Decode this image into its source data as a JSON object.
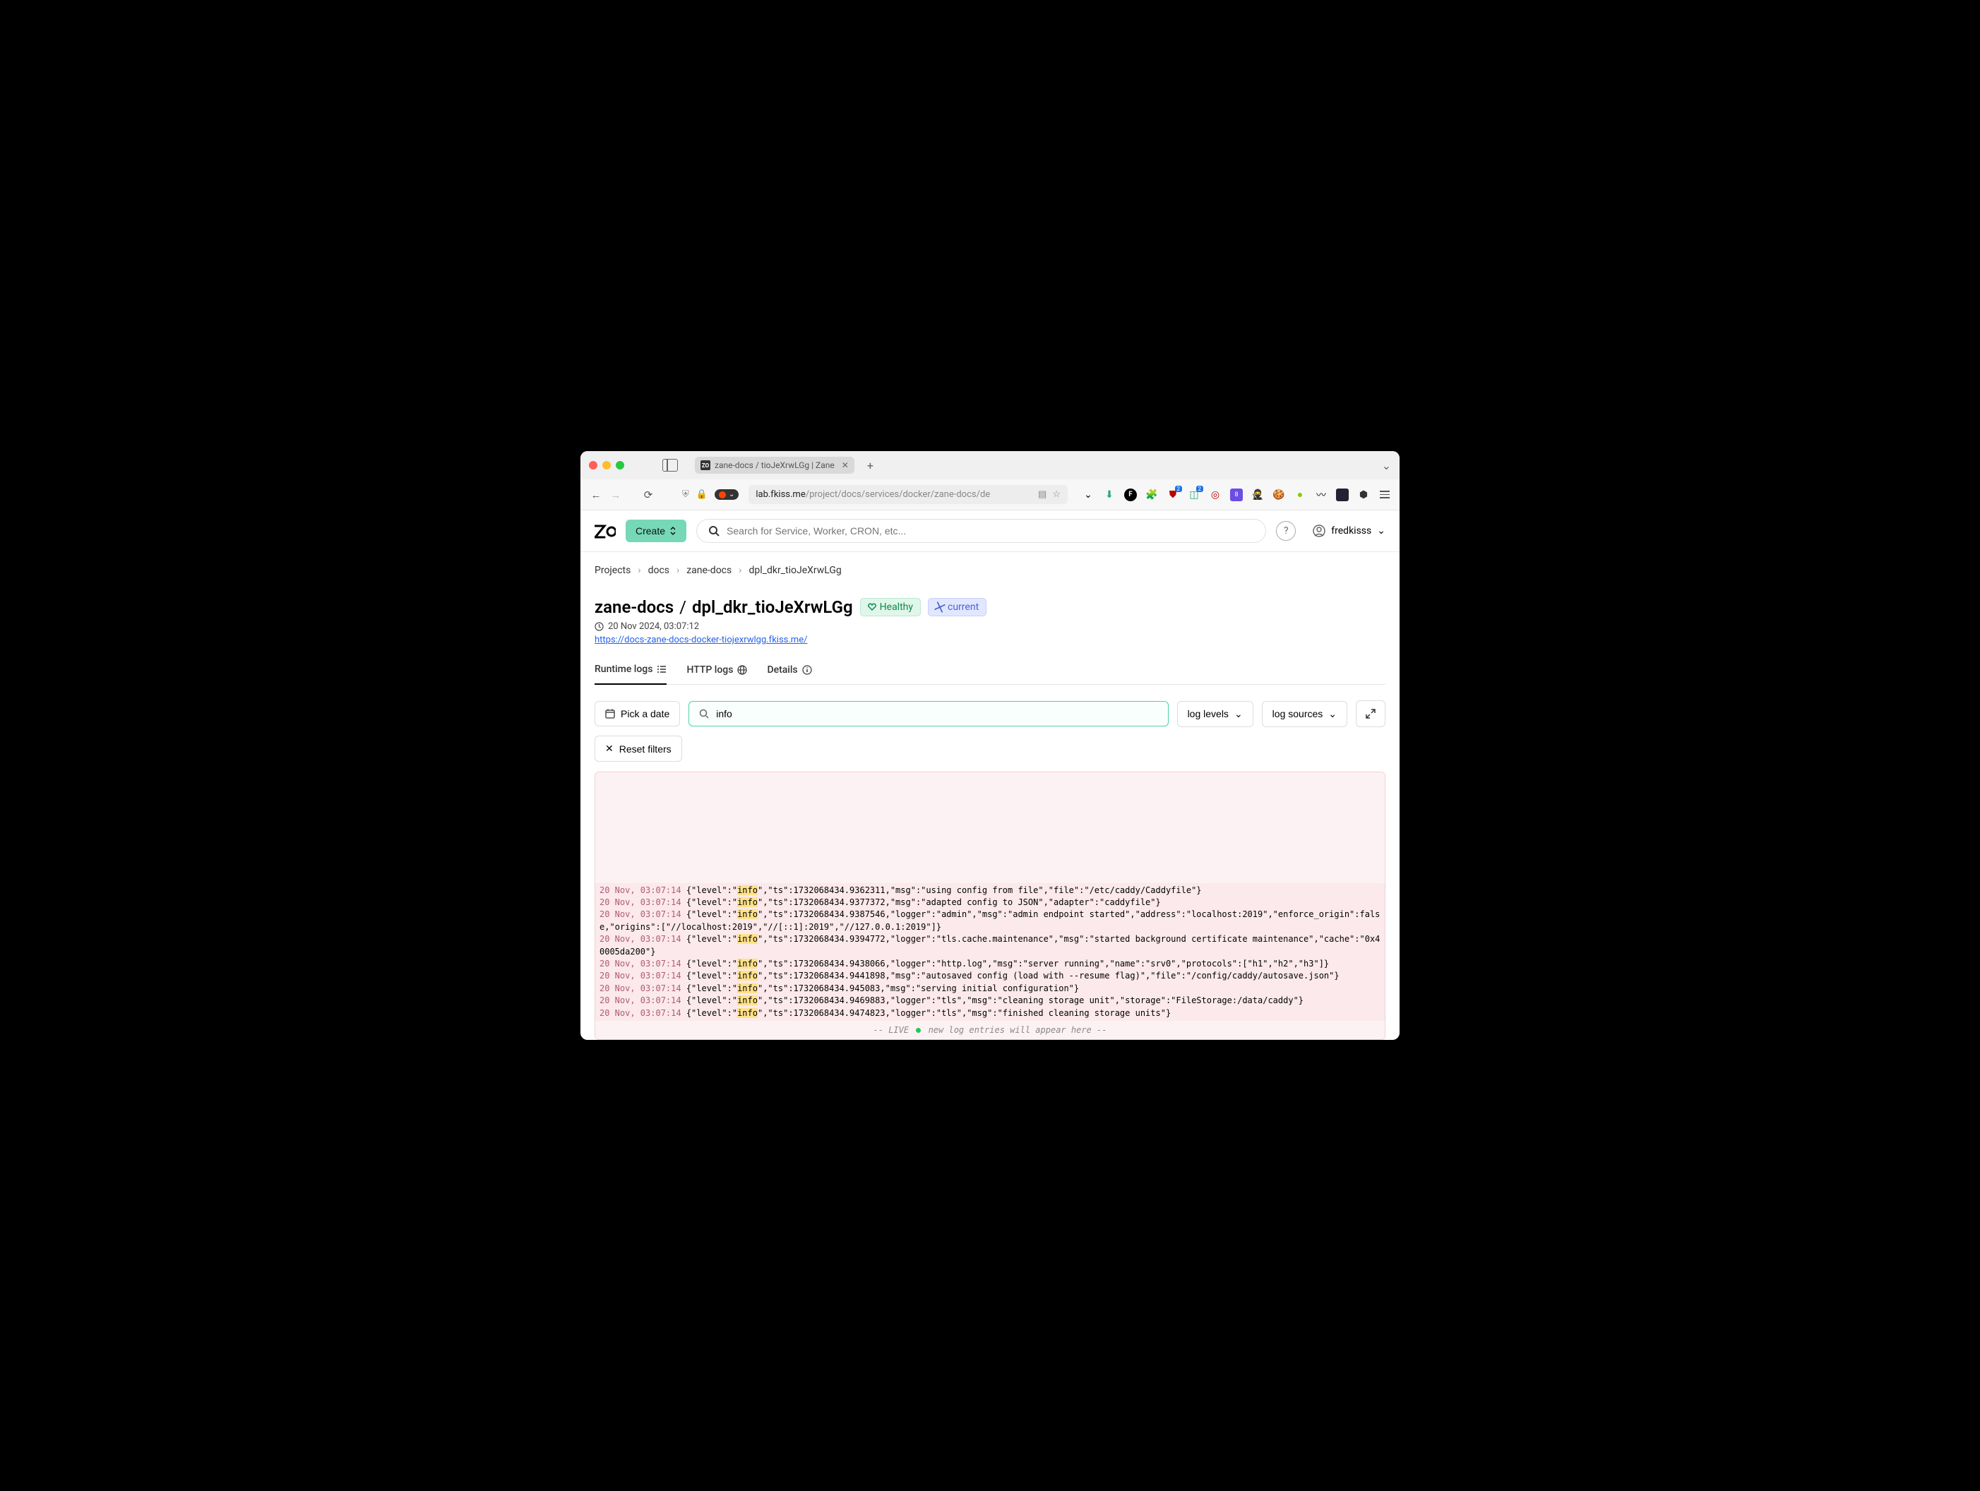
{
  "browser": {
    "tab_title": "zane-docs / tioJeXrwLGg | Zane",
    "url_host": "lab.fkiss.me",
    "url_path": "/project/docs/services/docker/zane-docs/de"
  },
  "header": {
    "create_label": "Create",
    "search_placeholder": "Search for Service, Worker, CRON, etc...",
    "username": "fredkisss"
  },
  "breadcrumb": {
    "items": [
      "Projects",
      "docs",
      "zane-docs",
      "dpl_dkr_tioJeXrwLGg"
    ]
  },
  "page": {
    "title_service": "zane-docs",
    "title_sep": "/",
    "title_dpl": "dpl_dkr_tioJeXrwLGg",
    "badge_healthy": "Healthy",
    "badge_current": "current",
    "timestamp": "20 Nov 2024, 03:07:12",
    "url": "https://docs-zane-docs-docker-tiojexrwlgg.fkiss.me/"
  },
  "tabs": {
    "runtime": "Runtime logs",
    "http": "HTTP logs",
    "details": "Details"
  },
  "filters": {
    "date": "Pick a date",
    "search_value": "info",
    "log_levels": "log levels",
    "log_sources": "log sources",
    "reset": "Reset filters"
  },
  "logs": {
    "highlight": "info",
    "lines": [
      {
        "ts": "20 Nov, 03:07:14",
        "pre": "{\"level\":\"",
        "post": "\",\"ts\":1732068434.9362311,\"msg\":\"using config from file\",\"file\":\"/etc/caddy/Caddyfile\"}"
      },
      {
        "ts": "20 Nov, 03:07:14",
        "pre": "{\"level\":\"",
        "post": "\",\"ts\":1732068434.9377372,\"msg\":\"adapted config to JSON\",\"adapter\":\"caddyfile\"}"
      },
      {
        "ts": "20 Nov, 03:07:14",
        "pre": "{\"level\":\"",
        "post": "\",\"ts\":1732068434.9387546,\"logger\":\"admin\",\"msg\":\"admin endpoint started\",\"address\":\"localhost:2019\",\"enforce_origin\":false,\"origins\":[\"//localhost:2019\",\"//[::1]:2019\",\"//127.0.0.1:2019\"]}"
      },
      {
        "ts": "20 Nov, 03:07:14",
        "pre": "{\"level\":\"",
        "post": "\",\"ts\":1732068434.9394772,\"logger\":\"tls.cache.maintenance\",\"msg\":\"started background certificate maintenance\",\"cache\":\"0x40005da200\"}"
      },
      {
        "ts": "20 Nov, 03:07:14",
        "pre": "{\"level\":\"",
        "post": "\",\"ts\":1732068434.9438066,\"logger\":\"http.log\",\"msg\":\"server running\",\"name\":\"srv0\",\"protocols\":[\"h1\",\"h2\",\"h3\"]}"
      },
      {
        "ts": "20 Nov, 03:07:14",
        "pre": "{\"level\":\"",
        "post": "\",\"ts\":1732068434.9441898,\"msg\":\"autosaved config (load with --resume flag)\",\"file\":\"/config/caddy/autosave.json\"}"
      },
      {
        "ts": "20 Nov, 03:07:14",
        "pre": "{\"level\":\"",
        "post": "\",\"ts\":1732068434.945083,\"msg\":\"serving initial configuration\"}"
      },
      {
        "ts": "20 Nov, 03:07:14",
        "pre": "{\"level\":\"",
        "post": "\",\"ts\":1732068434.9469883,\"logger\":\"tls\",\"msg\":\"cleaning storage unit\",\"storage\":\"FileStorage:/data/caddy\"}"
      },
      {
        "ts": "20 Nov, 03:07:14",
        "pre": "{\"level\":\"",
        "post": "\",\"ts\":1732068434.9474823,\"logger\":\"tls\",\"msg\":\"finished cleaning storage units\"}"
      }
    ],
    "footer_pre": "-- LIVE",
    "footer_post": "new log entries will appear here --"
  }
}
